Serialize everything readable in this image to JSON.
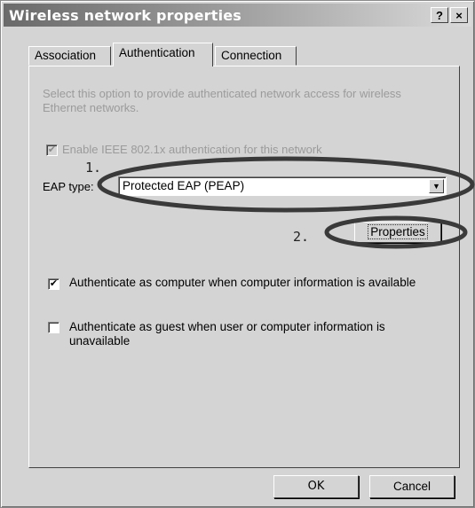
{
  "window": {
    "title": "Wireless network properties",
    "help_label": "?",
    "close_label": "×"
  },
  "tabs": [
    {
      "label": "Association"
    },
    {
      "label": "Authentication",
      "active": true
    },
    {
      "label": "Connection"
    }
  ],
  "auth": {
    "description": "Select this option to provide authenticated network access for wireless Ethernet networks.",
    "enable_8021x_label": "Enable IEEE 802.1x authentication for this network",
    "enable_8021x_checked": true,
    "eap_type_label": "EAP type:",
    "eap_type_value": "Protected EAP (PEAP)",
    "properties_label": "Properties",
    "auth_as_computer_label": "Authenticate as computer when computer information is available",
    "auth_as_computer_checked": true,
    "auth_as_guest_label": "Authenticate as guest when user or computer information is unavailable",
    "auth_as_guest_checked": false
  },
  "annotations": {
    "step1": "1.",
    "step2": "2."
  },
  "footer": {
    "ok_label": "OK",
    "cancel_label": "Cancel"
  }
}
